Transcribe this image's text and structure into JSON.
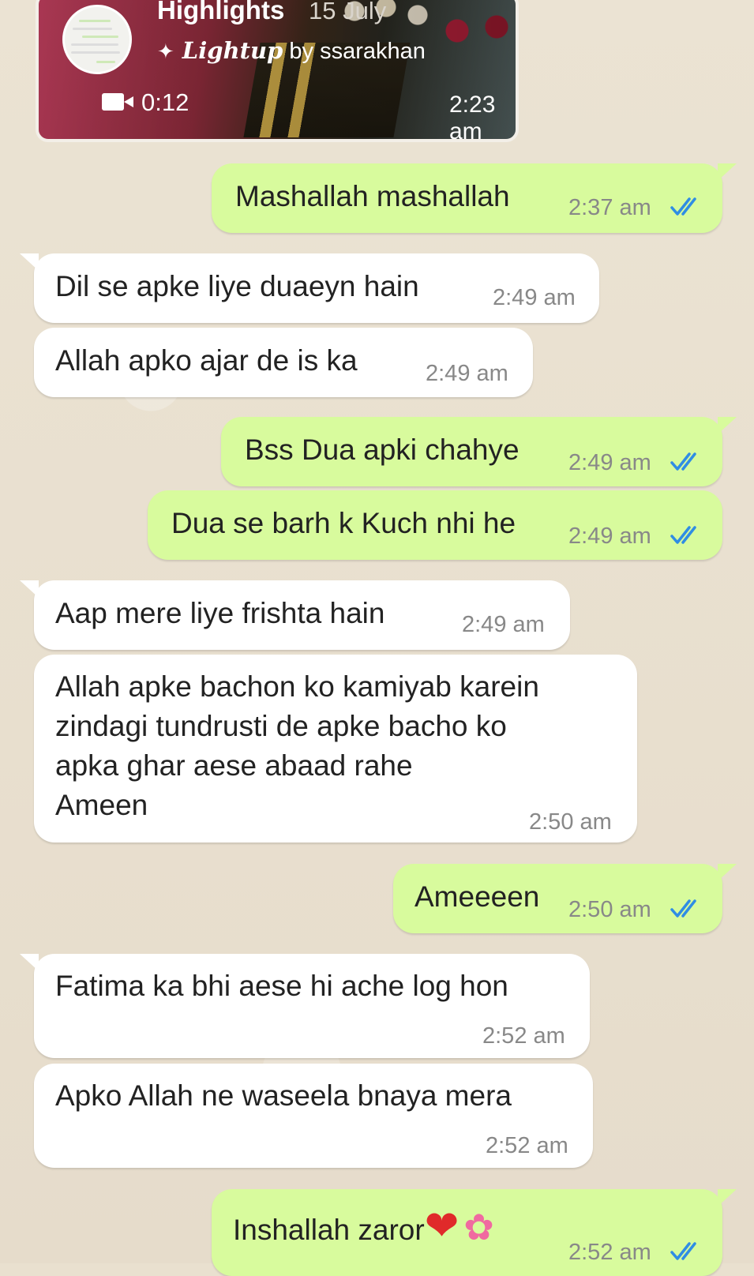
{
  "story": {
    "title": "Highlights",
    "date": "15 July",
    "credit_brand": "Lightup",
    "credit_suffix": "by ssarakhan",
    "duration": "0:12",
    "time": "2:23 am",
    "icons": [
      "sparkle-icon",
      "video-camera-icon"
    ]
  },
  "colors": {
    "incoming_bubble": "#ffffff",
    "outgoing_bubble": "#d8fb9d",
    "read_ticks": "#2f8de4"
  },
  "messages": [
    {
      "direction": "out",
      "text": "Mashallah mashallah",
      "time": "2:37 am",
      "status": "read"
    },
    {
      "direction": "in",
      "text": "Dil se apke liye duaeyn hain",
      "time": "2:49 am"
    },
    {
      "direction": "in",
      "text": "Allah apko ajar de is ka",
      "time": "2:49 am"
    },
    {
      "direction": "out",
      "text": "Bss Dua apki chahye",
      "time": "2:49 am",
      "status": "read"
    },
    {
      "direction": "out",
      "text": "Dua se barh k Kuch nhi he",
      "time": "2:49 am",
      "status": "read"
    },
    {
      "direction": "in",
      "text": "Aap mere liye frishta hain",
      "time": "2:49 am"
    },
    {
      "direction": "in",
      "text": "Allah apke bachon ko kamiyab karein\nzindagi tundrusti de apke bacho ko\napka ghar aese abaad rahe\nAmeen",
      "time": "2:50 am"
    },
    {
      "direction": "out",
      "text": "Ameeeen",
      "time": "2:50 am",
      "status": "read"
    },
    {
      "direction": "in",
      "text": "Fatima ka bhi aese hi ache log hon",
      "time": "2:52 am"
    },
    {
      "direction": "in",
      "text": "Apko Allah ne waseela bnaya mera",
      "time": "2:52 am"
    },
    {
      "direction": "out",
      "text": "Inshallah zaror",
      "emoji": [
        "❤",
        "✿"
      ],
      "time": "2:52 am",
      "status": "read"
    }
  ]
}
